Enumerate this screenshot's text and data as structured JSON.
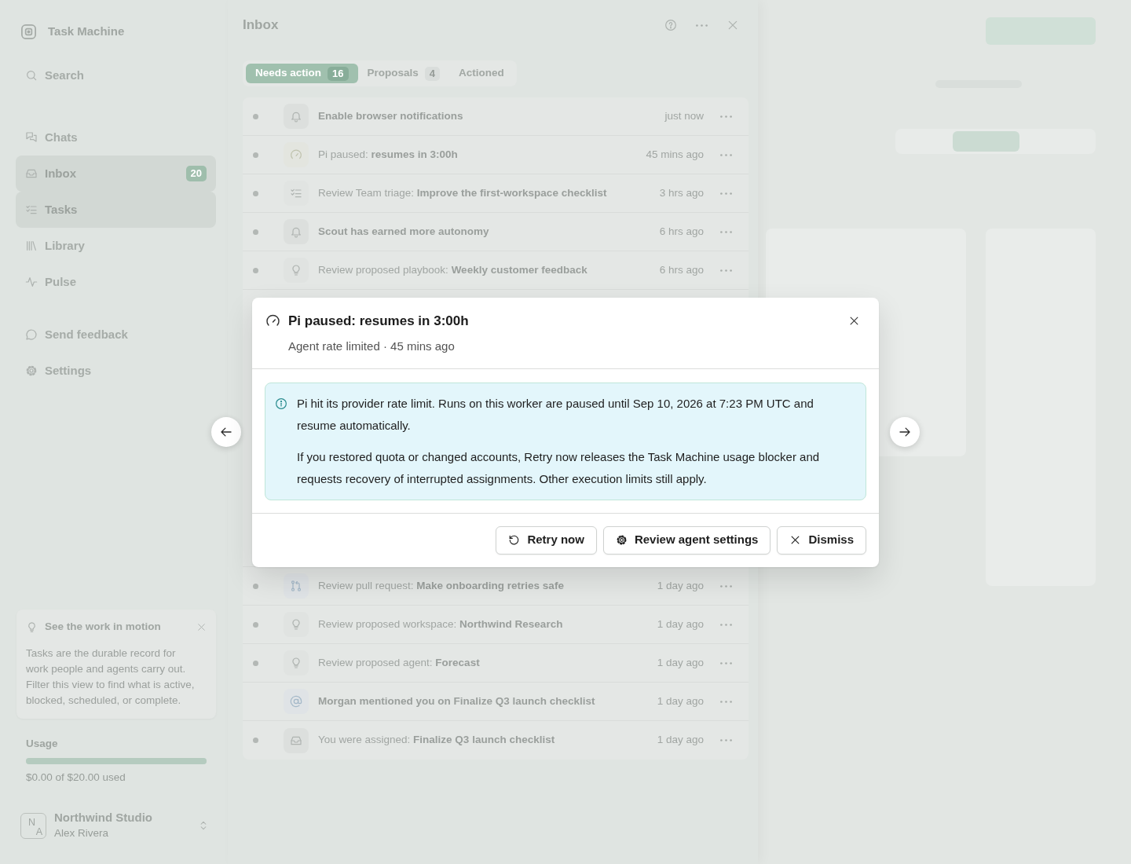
{
  "sidebar": {
    "brand": "Task Machine",
    "search": "Search",
    "nav": [
      {
        "kind": "chats",
        "label": "Chats",
        "selected": false
      },
      {
        "kind": "inbox",
        "label": "Inbox",
        "badge": "20",
        "selected": true
      },
      {
        "kind": "tasks",
        "label": "Tasks",
        "selected": true
      },
      {
        "kind": "library",
        "label": "Library",
        "selected": false
      },
      {
        "kind": "pulse",
        "label": "Pulse",
        "selected": false
      }
    ],
    "links": [
      {
        "kind": "feedback",
        "label": "Send feedback"
      },
      {
        "kind": "settings",
        "label": "Settings"
      }
    ],
    "tip": {
      "title": "See the work in motion",
      "body": "Tasks are the durable record for work people and agents carry out. Filter this view to find what is active, blocked, scheduled, or complete."
    },
    "usage": {
      "label": "Usage",
      "level": 1,
      "reading": "$0.00 of $20.00 used"
    },
    "workspace": {
      "initials": [
        "N",
        "A"
      ],
      "name": "Northwind Studio",
      "user": "Alex Rivera"
    }
  },
  "inbox": {
    "title": "Inbox",
    "tabs": [
      {
        "label": "Needs action",
        "count": "16",
        "selected": true
      },
      {
        "label": "Proposals",
        "count": "4",
        "selected": false
      },
      {
        "label": "Actioned",
        "selected": false
      }
    ],
    "items": [
      {
        "kind": "notification",
        "unread": true,
        "title": "Enable browser notifications",
        "time": "just now"
      },
      {
        "kind": "pause",
        "unread": true,
        "prefix": "Pi paused:",
        "title": "resumes in 3:00h",
        "time": "45 mins ago"
      },
      {
        "kind": "task",
        "unread": true,
        "prefix": "Review Team triage:",
        "title": "Improve the first-workspace checklist",
        "time": "3 hrs ago"
      },
      {
        "kind": "notification",
        "unread": true,
        "title": "Scout has earned more autonomy",
        "time": "6 hrs ago"
      },
      {
        "kind": "proposal",
        "unread": true,
        "prefix": "Review proposed playbook:",
        "title": "Weekly customer feedback",
        "time": "6 hrs ago"
      }
    ],
    "items_below_dialog": [
      {
        "kind": "pull_request",
        "unread": true,
        "prefix": "Review pull request:",
        "title": "Make onboarding retries safe",
        "time": "1 day ago"
      },
      {
        "kind": "proposal",
        "unread": true,
        "prefix": "Review proposed workspace:",
        "title": "Northwind Research",
        "time": "1 day ago"
      },
      {
        "kind": "proposal",
        "unread": true,
        "prefix": "Review proposed agent:",
        "title": "Forecast",
        "time": "1 day ago"
      },
      {
        "kind": "mention",
        "unread": false,
        "title": "Morgan mentioned you on Finalize Q3 launch checklist",
        "time": "1 day ago"
      },
      {
        "kind": "assignment",
        "unread": true,
        "prefix": "You were assigned:",
        "title": "Finalize Q3 launch checklist",
        "time": "1 day ago"
      }
    ]
  },
  "dialog": {
    "kind": "pause",
    "title": "Pi paused: resumes in 3:00h",
    "subtitle": "Agent rate limited · 45 mins ago",
    "notice": [
      "Pi hit its provider rate limit. Runs on this worker are paused until Sep 10, 2026 at 7:23 PM UTC and resume automatically.",
      "If you restored quota or changed accounts, Retry now releases the Task Machine usage blocker and requests recovery of interrupted assignments. Other execution limits still apply."
    ],
    "buttons": [
      {
        "kind": "retry",
        "label": "Retry now"
      },
      {
        "kind": "settings",
        "label": "Review agent settings"
      },
      {
        "kind": "dismiss",
        "label": "Dismiss"
      }
    ]
  }
}
